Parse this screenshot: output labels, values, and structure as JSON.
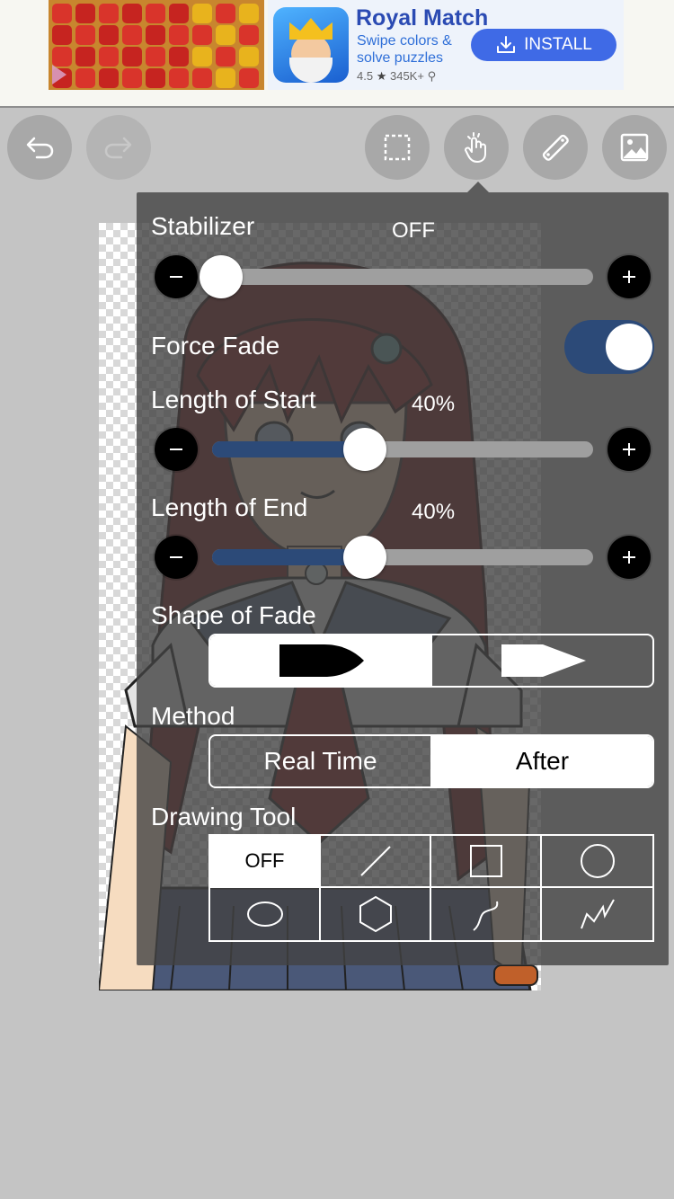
{
  "ad": {
    "title": "Royal Match",
    "subtitle": "Swipe colors & solve puzzles",
    "rating": "4.5",
    "rating_count": "345K+",
    "install_label": "INSTALL"
  },
  "toolbar": {
    "items": [
      {
        "name": "undo-icon",
        "enabled": true
      },
      {
        "name": "redo-icon",
        "enabled": false
      },
      {
        "name": "selection-icon",
        "enabled": true
      },
      {
        "name": "hand-icon",
        "enabled": true
      },
      {
        "name": "ruler-icon",
        "enabled": true
      },
      {
        "name": "layer-image-icon",
        "enabled": true
      }
    ]
  },
  "panel": {
    "stabilizer": {
      "label": "Stabilizer",
      "value_text": "OFF",
      "level": 0
    },
    "force_fade": {
      "label": "Force Fade",
      "on": true
    },
    "length_start": {
      "label": "Length of Start",
      "value_text": "40%",
      "level": 0.4
    },
    "length_end": {
      "label": "Length of End",
      "value_text": "40%",
      "level": 0.4
    },
    "shape_of_fade": {
      "label": "Shape of Fade",
      "options": [
        "round-fade-shape",
        "sharp-fade-shape"
      ],
      "selected": 0
    },
    "method": {
      "label": "Method",
      "options": [
        "Real Time",
        "After"
      ],
      "selected": 1
    },
    "drawing_tool": {
      "label": "Drawing Tool",
      "options": [
        "OFF",
        "line-icon",
        "rectangle-icon",
        "circle-icon",
        "ellipse-icon",
        "polygon-icon",
        "curve-icon",
        "polyline-icon"
      ],
      "off_label": "OFF",
      "selected": 0
    }
  },
  "colors": {
    "accent": "#2c4a78",
    "panel_bg": "#424242",
    "toolbar_btn": "#a8a8a8",
    "ad_blue": "#3f6ae6"
  }
}
